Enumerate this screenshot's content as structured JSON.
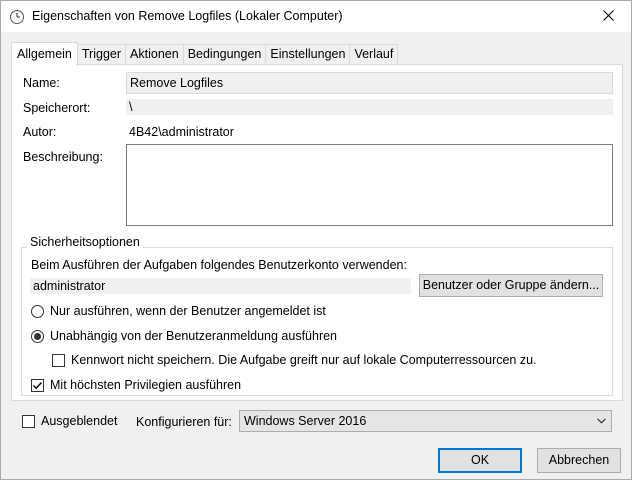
{
  "window": {
    "title": "Eigenschaften von Remove Logfiles (Lokaler Computer)",
    "icons": {
      "app": "clock-icon",
      "close": "close-icon"
    }
  },
  "tabs": [
    {
      "label": "Allgemein",
      "active": true
    },
    {
      "label": "Trigger",
      "active": false
    },
    {
      "label": "Aktionen",
      "active": false
    },
    {
      "label": "Bedingungen",
      "active": false
    },
    {
      "label": "Einstellungen",
      "active": false
    },
    {
      "label": "Verlauf",
      "active": false
    }
  ],
  "general": {
    "name_label": "Name:",
    "name_value": "Remove Logfiles",
    "location_label": "Speicherort:",
    "location_value": "\\",
    "author_label": "Autor:",
    "author_value": "4B42\\administrator",
    "description_label": "Beschreibung:",
    "description_value": ""
  },
  "security": {
    "group_title": "Sicherheitsoptionen",
    "account_prompt": "Beim Ausführen der Aufgaben folgendes Benutzerkonto verwenden:",
    "account_value": "administrator",
    "change_user_button": "Benutzer oder Gruppe ändern...",
    "radio_logged_on": {
      "label": "Nur ausführen, wenn der Benutzer angemeldet ist",
      "checked": false
    },
    "radio_independent": {
      "label": "Unabhängig von der Benutzeranmeldung ausführen",
      "checked": true
    },
    "no_store_password": {
      "label": "Kennwort nicht speichern. Die Aufgabe greift nur auf lokale Computerressourcen zu.",
      "checked": false
    },
    "highest_privileges": {
      "label": "Mit höchsten Privilegien ausführen",
      "checked": true
    }
  },
  "footer": {
    "hidden": {
      "label": "Ausgeblendet",
      "checked": false
    },
    "configure_label": "Konfigurieren für:",
    "configure_value": "Windows Server 2016"
  },
  "buttons": {
    "ok": "OK",
    "cancel": "Abbrechen"
  },
  "colors": {
    "focus_border": "#0078d7",
    "readonly_bg": "#f0f0f0",
    "dialog_bg": "#f0f0f0"
  }
}
